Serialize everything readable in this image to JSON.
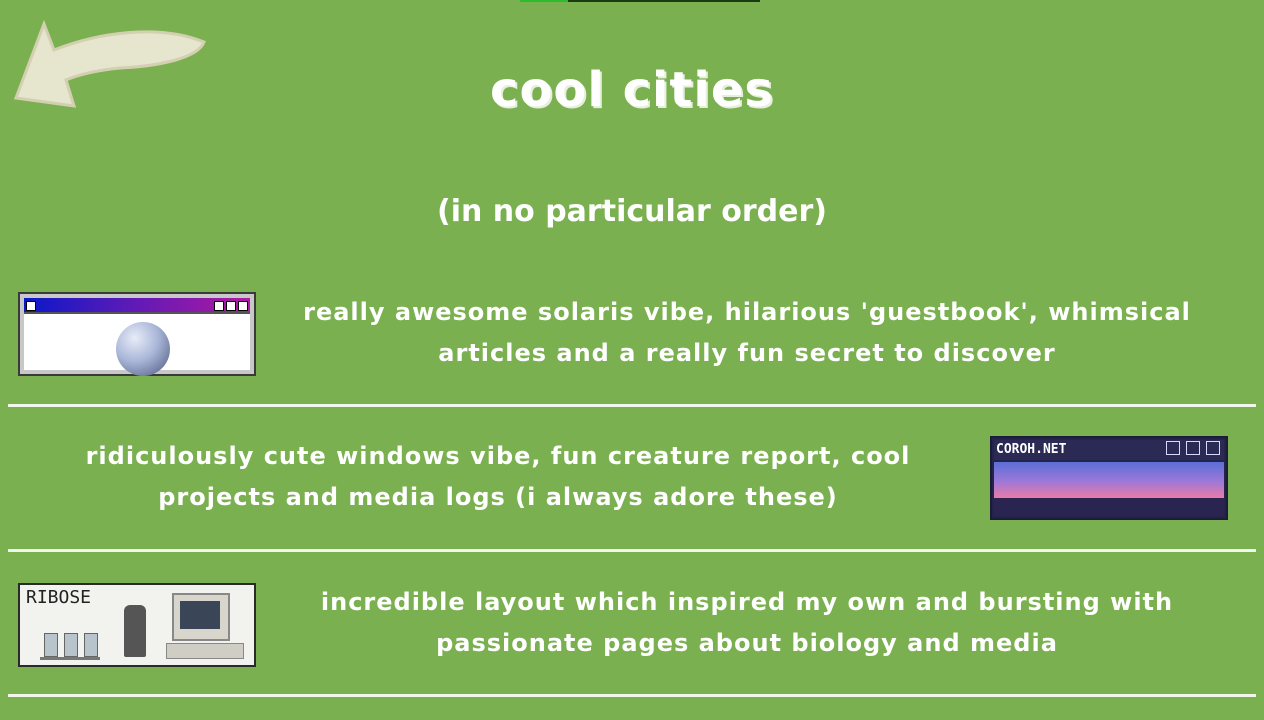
{
  "header": {
    "title": "cool cities",
    "subtitle": "(in no particular order)"
  },
  "sites": [
    {
      "button_alt": "solaris window button",
      "description": "really awesome solaris vibe, hilarious 'guestbook', whimsical articles and a really fun secret to discover"
    },
    {
      "button_text": "COROH.NET",
      "description": "ridiculously cute windows vibe, fun creature report, cool projects and media logs (i always adore these)"
    },
    {
      "button_text": "RIBOSE",
      "description": "incredible layout which inspired my own and bursting with passionate pages about biology and media"
    }
  ],
  "colors": {
    "background": "#7ab04f",
    "text": "#ffffff",
    "divider": "#f1f6ea"
  },
  "icons": {
    "back": "back-arrow-icon"
  }
}
